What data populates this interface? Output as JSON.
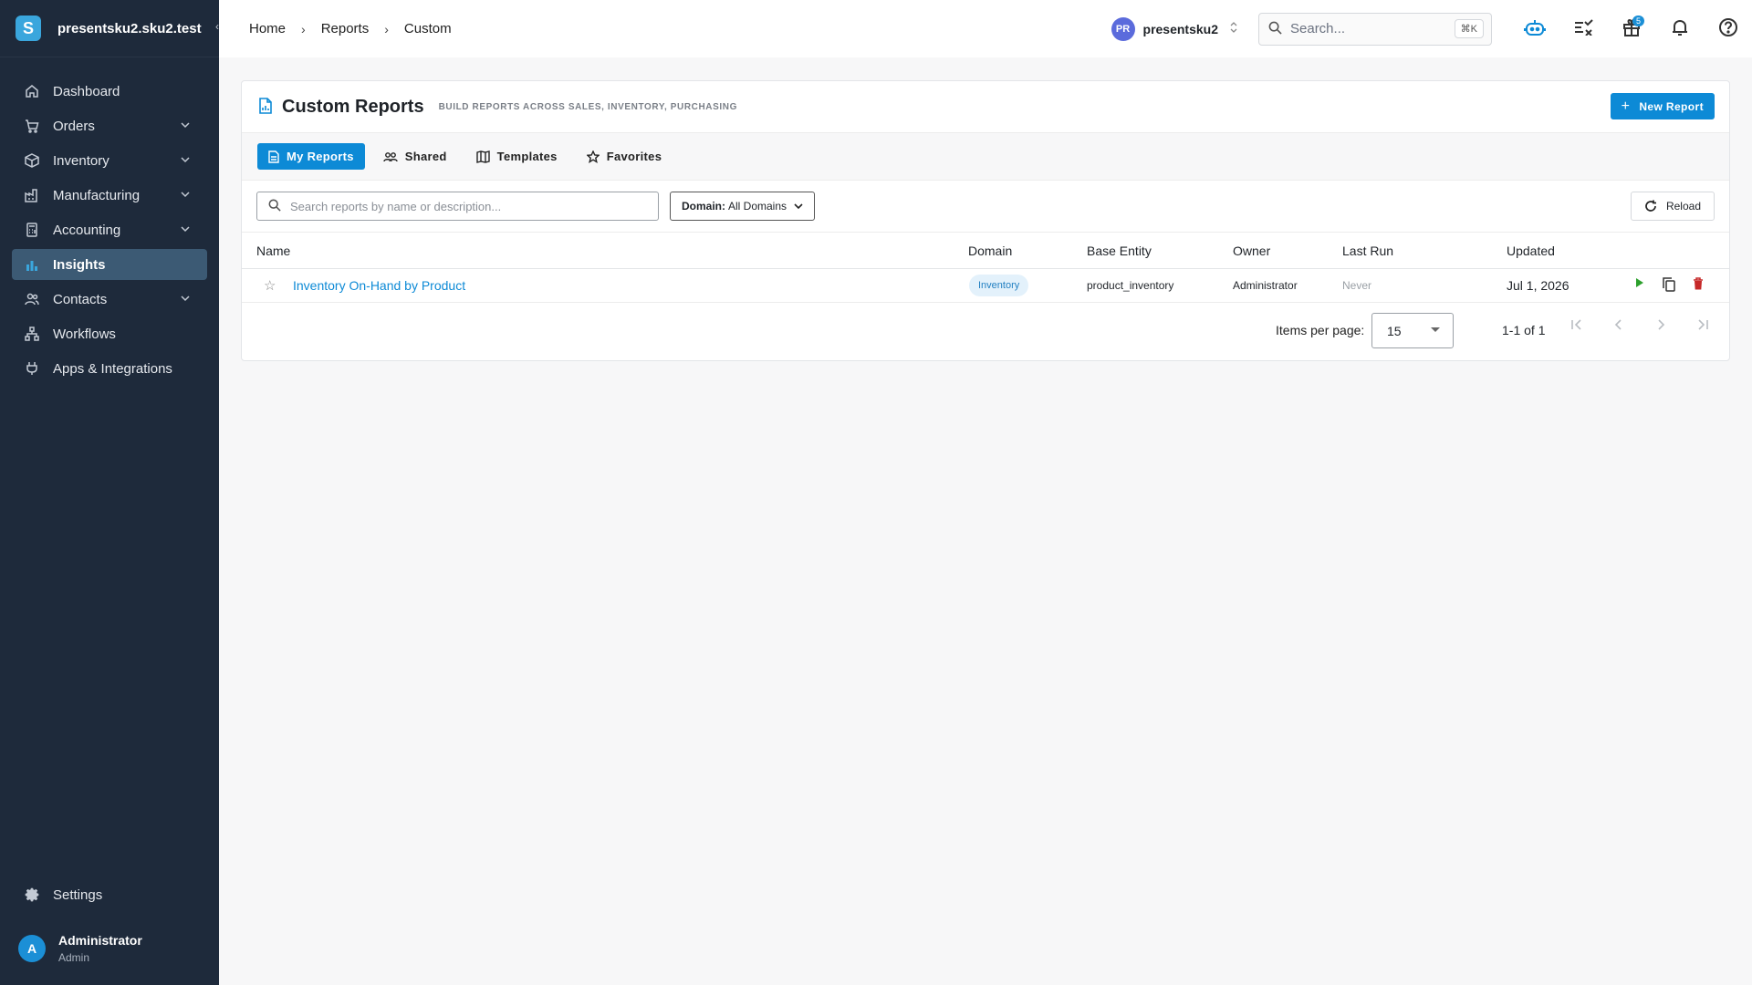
{
  "sidebar": {
    "tenant": "presentsku2.sku2.test",
    "logo_letter": "S",
    "items": [
      {
        "label": "Dashboard",
        "icon": "home-icon",
        "has_children": false
      },
      {
        "label": "Orders",
        "icon": "cart-icon",
        "has_children": true
      },
      {
        "label": "Inventory",
        "icon": "box-icon",
        "has_children": true
      },
      {
        "label": "Manufacturing",
        "icon": "factory-icon",
        "has_children": true
      },
      {
        "label": "Accounting",
        "icon": "calculator-icon",
        "has_children": true
      },
      {
        "label": "Insights",
        "icon": "bar-chart-icon",
        "has_children": false,
        "active": true
      },
      {
        "label": "Contacts",
        "icon": "contacts-icon",
        "has_children": true
      },
      {
        "label": "Workflows",
        "icon": "workflow-icon",
        "has_children": false
      },
      {
        "label": "Apps & Integrations",
        "icon": "plug-icon",
        "has_children": false
      }
    ],
    "settings_label": "Settings",
    "user": {
      "initial": "A",
      "name": "Administrator",
      "role": "Admin"
    }
  },
  "topbar": {
    "breadcrumb": [
      "Home",
      "Reports",
      "Custom"
    ],
    "tenant_switch": {
      "initials": "PR",
      "name": "presentsku2"
    },
    "search_placeholder": "Search...",
    "search_shortcut": "⌘K",
    "gift_badge": "5"
  },
  "page": {
    "title": "Custom Reports",
    "subtitle": "BUILD REPORTS ACROSS SALES, INVENTORY, PURCHASING",
    "new_button": "New Report",
    "tabs": [
      {
        "label": "My Reports",
        "icon": "document-icon",
        "active": true
      },
      {
        "label": "Shared",
        "icon": "users-icon",
        "active": false
      },
      {
        "label": "Templates",
        "icon": "template-icon",
        "active": false
      },
      {
        "label": "Favorites",
        "icon": "star-icon",
        "active": false
      }
    ],
    "filter_placeholder": "Search reports by name or description...",
    "domain_filter": {
      "label": "Domain:",
      "value": "All Domains"
    },
    "reload_label": "Reload",
    "columns": [
      "Name",
      "Domain",
      "Base Entity",
      "Owner",
      "Last Run",
      "Updated"
    ],
    "rows": [
      {
        "name": "Inventory On-Hand by Product",
        "domain": "Inventory",
        "base_entity": "product_inventory",
        "owner": "Administrator",
        "last_run": "Never",
        "updated": "Jul 1, 2026"
      }
    ],
    "pagination": {
      "items_per_page_label": "Items per page:",
      "items_per_page": "15",
      "range": "1-1 of 1"
    }
  },
  "colors": {
    "accent": "#0d8ad6",
    "sidebar_bg": "#1e2a3b",
    "run": "#2ca02c",
    "delete": "#c62828"
  }
}
